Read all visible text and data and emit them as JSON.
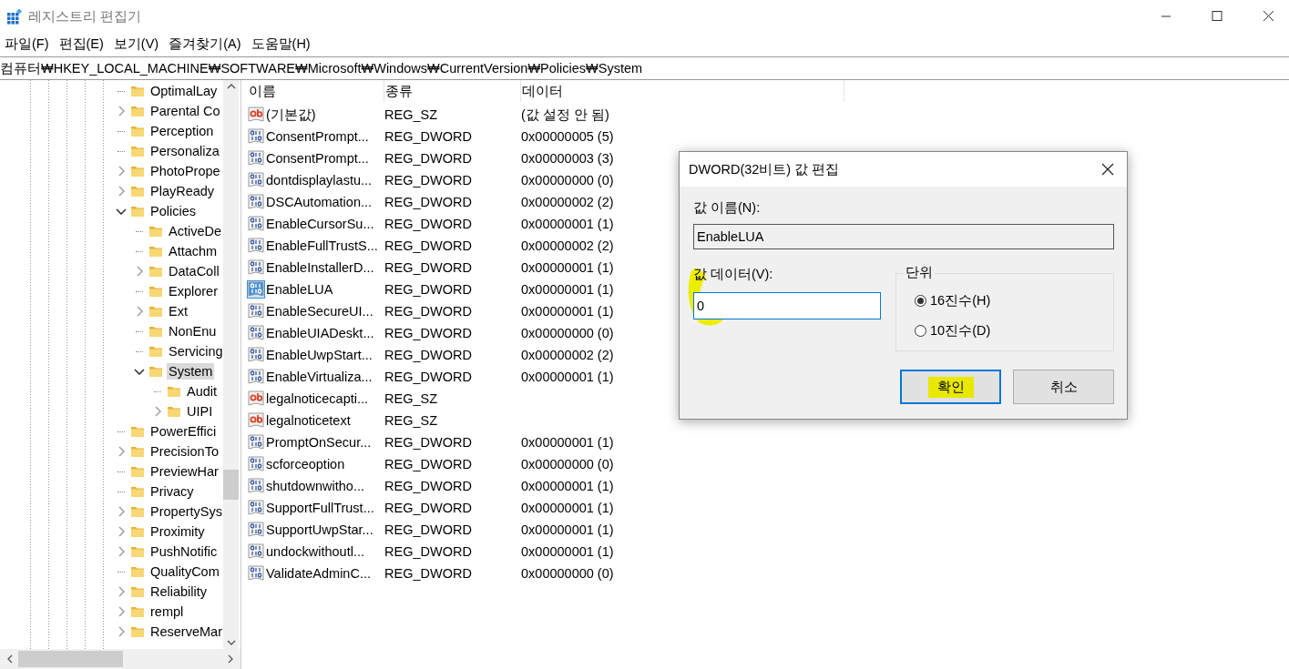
{
  "window": {
    "title": "레지스트리 편집기"
  },
  "menu": [
    "파일(F)",
    "편집(E)",
    "보기(V)",
    "즐겨찾기(A)",
    "도움말(H)"
  ],
  "address": "컴퓨터₩HKEY_LOCAL_MACHINE₩SOFTWARE₩Microsoft₩Windows₩CurrentVersion₩Policies₩System",
  "tree": [
    {
      "label": "OptimalLay",
      "expandable": false,
      "selected": false
    },
    {
      "label": "Parental Co",
      "expandable": true,
      "expanded": false,
      "selected": false
    },
    {
      "label": "Perception",
      "expandable": false,
      "selected": false
    },
    {
      "label": "Personaliza",
      "expandable": false,
      "selected": false
    },
    {
      "label": "PhotoPrope",
      "expandable": true,
      "expanded": false,
      "selected": false
    },
    {
      "label": "PlayReady",
      "expandable": true,
      "expanded": false,
      "selected": false
    },
    {
      "label": "Policies",
      "expandable": true,
      "expanded": true,
      "selected": false,
      "children": [
        {
          "label": "ActiveDe",
          "expandable": false,
          "selected": false
        },
        {
          "label": "Attachm",
          "expandable": false,
          "selected": false
        },
        {
          "label": "DataColl",
          "expandable": true,
          "expanded": false,
          "selected": false
        },
        {
          "label": "Explorer",
          "expandable": false,
          "selected": false
        },
        {
          "label": "Ext",
          "expandable": true,
          "expanded": false,
          "selected": false
        },
        {
          "label": "NonEnu",
          "expandable": false,
          "selected": false
        },
        {
          "label": "Servicing",
          "expandable": false,
          "selected": false
        },
        {
          "label": "System",
          "expandable": true,
          "expanded": true,
          "selected": true,
          "children": [
            {
              "label": "Audit",
              "expandable": false,
              "selected": false
            },
            {
              "label": "UIPI",
              "expandable": true,
              "expanded": false,
              "selected": false
            }
          ]
        }
      ]
    },
    {
      "label": "PowerEffici",
      "expandable": false,
      "selected": false
    },
    {
      "label": "PrecisionTo",
      "expandable": true,
      "expanded": false,
      "selected": false
    },
    {
      "label": "PreviewHar",
      "expandable": false,
      "selected": false
    },
    {
      "label": "Privacy",
      "expandable": false,
      "selected": false
    },
    {
      "label": "PropertySys",
      "expandable": true,
      "expanded": false,
      "selected": false
    },
    {
      "label": "Proximity",
      "expandable": true,
      "expanded": false,
      "selected": false
    },
    {
      "label": "PushNotific",
      "expandable": true,
      "expanded": false,
      "selected": false
    },
    {
      "label": "QualityCom",
      "expandable": false,
      "selected": false
    },
    {
      "label": "Reliability",
      "expandable": true,
      "expanded": false,
      "selected": false
    },
    {
      "label": "rempl",
      "expandable": true,
      "expanded": false,
      "selected": false
    },
    {
      "label": "ReserveMar",
      "expandable": true,
      "expanded": false,
      "selected": false
    }
  ],
  "table": {
    "columns": [
      "이름",
      "종류",
      "데이터"
    ],
    "rows": [
      {
        "kind": "string",
        "selected": false,
        "name": "(기본값)",
        "type": "REG_SZ",
        "data": "(값 설정 안 됨)"
      },
      {
        "kind": "dword",
        "selected": false,
        "name": "ConsentPrompt...",
        "type": "REG_DWORD",
        "data": "0x00000005 (5)"
      },
      {
        "kind": "dword",
        "selected": false,
        "name": "ConsentPrompt...",
        "type": "REG_DWORD",
        "data": "0x00000003 (3)"
      },
      {
        "kind": "dword",
        "selected": false,
        "name": "dontdisplaylastu...",
        "type": "REG_DWORD",
        "data": "0x00000000 (0)"
      },
      {
        "kind": "dword",
        "selected": false,
        "name": "DSCAutomation...",
        "type": "REG_DWORD",
        "data": "0x00000002 (2)"
      },
      {
        "kind": "dword",
        "selected": false,
        "name": "EnableCursorSu...",
        "type": "REG_DWORD",
        "data": "0x00000001 (1)"
      },
      {
        "kind": "dword",
        "selected": false,
        "name": "EnableFullTrustS...",
        "type": "REG_DWORD",
        "data": "0x00000002 (2)"
      },
      {
        "kind": "dword",
        "selected": false,
        "name": "EnableInstallerD...",
        "type": "REG_DWORD",
        "data": "0x00000001 (1)"
      },
      {
        "kind": "dword",
        "selected": true,
        "name": "EnableLUA",
        "type": "REG_DWORD",
        "data": "0x00000001 (1)"
      },
      {
        "kind": "dword",
        "selected": false,
        "name": "EnableSecureUI...",
        "type": "REG_DWORD",
        "data": "0x00000001 (1)"
      },
      {
        "kind": "dword",
        "selected": false,
        "name": "EnableUIADeskt...",
        "type": "REG_DWORD",
        "data": "0x00000000 (0)"
      },
      {
        "kind": "dword",
        "selected": false,
        "name": "EnableUwpStart...",
        "type": "REG_DWORD",
        "data": "0x00000002 (2)"
      },
      {
        "kind": "dword",
        "selected": false,
        "name": "EnableVirtualiza...",
        "type": "REG_DWORD",
        "data": "0x00000001 (1)"
      },
      {
        "kind": "string",
        "selected": false,
        "name": "legalnoticecapti...",
        "type": "REG_SZ"
      },
      {
        "kind": "string",
        "selected": false,
        "name": "legalnoticetext",
        "type": "REG_SZ"
      },
      {
        "kind": "dword",
        "selected": false,
        "name": "PromptOnSecur...",
        "type": "REG_DWORD",
        "data": "0x00000001 (1)"
      },
      {
        "kind": "dword",
        "selected": false,
        "name": "scforceoption",
        "type": "REG_DWORD",
        "data": "0x00000000 (0)"
      },
      {
        "kind": "dword",
        "selected": false,
        "name": "shutdownwitho...",
        "type": "REG_DWORD",
        "data": "0x00000001 (1)"
      },
      {
        "kind": "dword",
        "selected": false,
        "name": "SupportFullTrust...",
        "type": "REG_DWORD",
        "data": "0x00000001 (1)"
      },
      {
        "kind": "dword",
        "selected": false,
        "name": "SupportUwpStar...",
        "type": "REG_DWORD",
        "data": "0x00000001 (1)"
      },
      {
        "kind": "dword",
        "selected": false,
        "name": "undockwithoutl...",
        "type": "REG_DWORD",
        "data": "0x00000001 (1)"
      },
      {
        "kind": "dword",
        "selected": false,
        "name": "ValidateAdminC...",
        "type": "REG_DWORD",
        "data": "0x00000000 (0)"
      }
    ]
  },
  "dialog": {
    "title": "DWORD(32비트) 값 편집",
    "name_label": "값 이름(N):",
    "name_value": "EnableLUA",
    "data_label": "값 데이터(V):",
    "data_value": "0",
    "data_highlighted": true,
    "unit_label": "단위",
    "radios": [
      {
        "label": "16진수(H)",
        "selected": true
      },
      {
        "label": "10진수(D)",
        "selected": false
      }
    ],
    "buttons": [
      {
        "label": "확인",
        "default": true,
        "highlighted": true
      },
      {
        "label": "취소",
        "default": false,
        "highlighted": false
      }
    ]
  }
}
